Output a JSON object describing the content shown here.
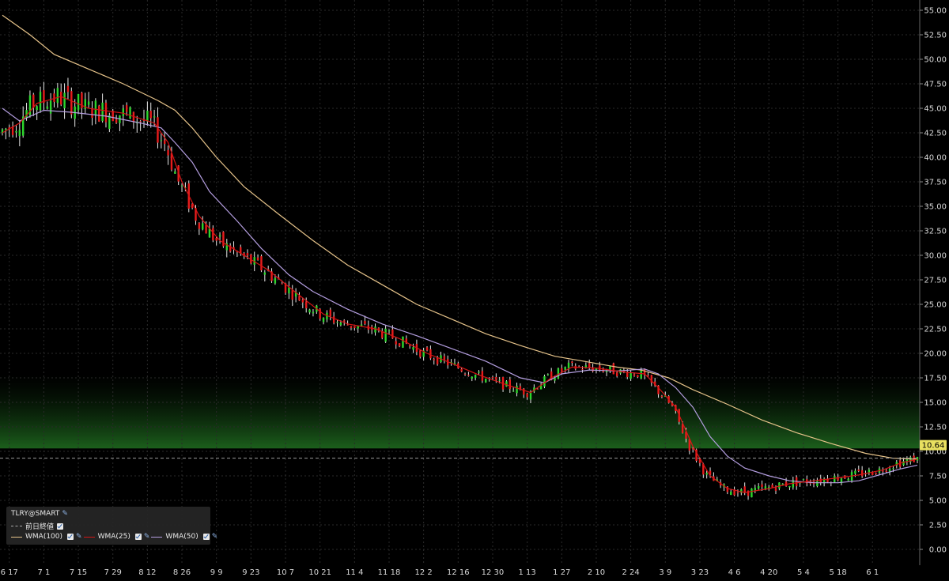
{
  "chart_data": {
    "type": "candlestick",
    "symbol_label": "TLRY@SMART",
    "y_ticks": [
      "55.00",
      "52.50",
      "50.00",
      "47.50",
      "45.00",
      "42.50",
      "40.00",
      "37.50",
      "35.00",
      "32.50",
      "30.00",
      "27.50",
      "25.00",
      "22.50",
      "20.00",
      "17.50",
      "15.00",
      "12.50",
      "10.00",
      "7.50",
      "5.00",
      "2.50",
      "0.00"
    ],
    "x_ticks": [
      "6 17",
      "7 1",
      "7 15",
      "7 29",
      "8 12",
      "8 26",
      "9 9",
      "9 23",
      "10 7",
      "10 21",
      "11 4",
      "11 18",
      "12 2",
      "12 16",
      "12 30",
      "1 13",
      "1 27",
      "2 10",
      "2 24",
      "3 9",
      "3 23",
      "4 6",
      "4 20",
      "5 4",
      "5 18",
      "6 1"
    ],
    "ylim": [
      0,
      55
    ],
    "last_price": "10.64",
    "prev_close": 9.3,
    "colors": {
      "up": "#2dd62d",
      "down": "#e81c1c",
      "wma100": "#e6c38a",
      "wma25": "#d41515",
      "wma50": "#b49ee0",
      "last_price_bg": "#e8e060"
    },
    "wma100": [
      [
        0,
        54.5
      ],
      [
        8,
        52.5
      ],
      [
        15,
        50.5
      ],
      [
        25,
        49.0
      ],
      [
        35,
        47.5
      ],
      [
        45,
        45.8
      ],
      [
        50,
        44.8
      ],
      [
        55,
        43.0
      ],
      [
        62,
        40.0
      ],
      [
        70,
        37.0
      ],
      [
        80,
        34.2
      ],
      [
        90,
        31.5
      ],
      [
        100,
        29.0
      ],
      [
        110,
        27.0
      ],
      [
        120,
        25.0
      ],
      [
        130,
        23.5
      ],
      [
        140,
        22.0
      ],
      [
        150,
        20.8
      ],
      [
        160,
        19.7
      ],
      [
        170,
        19.1
      ],
      [
        178,
        18.6
      ],
      [
        185,
        18.3
      ],
      [
        193,
        17.5
      ],
      [
        200,
        16.3
      ],
      [
        210,
        14.8
      ],
      [
        220,
        13.2
      ],
      [
        230,
        11.9
      ],
      [
        240,
        10.8
      ],
      [
        250,
        9.8
      ],
      [
        258,
        9.3
      ],
      [
        265,
        9.2
      ]
    ],
    "wma25": [
      [
        0,
        42.5
      ],
      [
        5,
        43.5
      ],
      [
        10,
        45.5
      ],
      [
        17,
        46.2
      ],
      [
        25,
        45.0
      ],
      [
        35,
        44.5
      ],
      [
        44,
        43.5
      ],
      [
        48,
        41.5
      ],
      [
        52,
        37.5
      ],
      [
        57,
        34.0
      ],
      [
        63,
        31.5
      ],
      [
        70,
        30.0
      ],
      [
        77,
        28.5
      ],
      [
        85,
        26.2
      ],
      [
        93,
        24.0
      ],
      [
        100,
        23.0
      ],
      [
        108,
        22.5
      ],
      [
        115,
        21.5
      ],
      [
        123,
        20.0
      ],
      [
        130,
        19.0
      ],
      [
        138,
        17.8
      ],
      [
        146,
        16.8
      ],
      [
        153,
        16.0
      ],
      [
        159,
        17.5
      ],
      [
        165,
        18.6
      ],
      [
        172,
        18.5
      ],
      [
        180,
        18.1
      ],
      [
        186,
        17.9
      ],
      [
        190,
        16.5
      ],
      [
        195,
        14.5
      ],
      [
        200,
        10.5
      ],
      [
        205,
        7.5
      ],
      [
        210,
        6.2
      ],
      [
        215,
        5.8
      ],
      [
        222,
        6.2
      ],
      [
        228,
        6.7
      ],
      [
        235,
        7.0
      ],
      [
        242,
        7.3
      ],
      [
        248,
        7.6
      ],
      [
        255,
        8.1
      ],
      [
        260,
        8.8
      ],
      [
        265,
        9.2
      ]
    ],
    "wma50": [
      [
        0,
        45.0
      ],
      [
        5,
        43.7
      ],
      [
        12,
        44.8
      ],
      [
        20,
        44.6
      ],
      [
        30,
        44.2
      ],
      [
        40,
        43.5
      ],
      [
        46,
        43.0
      ],
      [
        50,
        41.5
      ],
      [
        55,
        39.5
      ],
      [
        60,
        36.5
      ],
      [
        68,
        33.5
      ],
      [
        75,
        30.7
      ],
      [
        83,
        28.0
      ],
      [
        90,
        26.3
      ],
      [
        100,
        24.5
      ],
      [
        110,
        23.0
      ],
      [
        120,
        21.8
      ],
      [
        130,
        20.5
      ],
      [
        140,
        19.2
      ],
      [
        150,
        17.5
      ],
      [
        157,
        17.0
      ],
      [
        162,
        17.9
      ],
      [
        170,
        18.3
      ],
      [
        178,
        18.2
      ],
      [
        186,
        18.4
      ],
      [
        190,
        17.9
      ],
      [
        195,
        16.5
      ],
      [
        200,
        14.5
      ],
      [
        205,
        11.5
      ],
      [
        210,
        9.5
      ],
      [
        215,
        8.3
      ],
      [
        222,
        7.5
      ],
      [
        228,
        7.0
      ],
      [
        235,
        6.8
      ],
      [
        242,
        6.8
      ],
      [
        248,
        7.0
      ],
      [
        255,
        7.7
      ],
      [
        260,
        8.2
      ],
      [
        265,
        8.6
      ]
    ]
  },
  "legend": {
    "title": "TLRY@SMART",
    "prev_close_label": "前日終値",
    "items": [
      {
        "label": "WMA(100)",
        "color": "#e6c38a"
      },
      {
        "label": "WMA(25)",
        "color": "#d41515"
      },
      {
        "label": "WMA(50)",
        "color": "#b49ee0"
      }
    ]
  }
}
